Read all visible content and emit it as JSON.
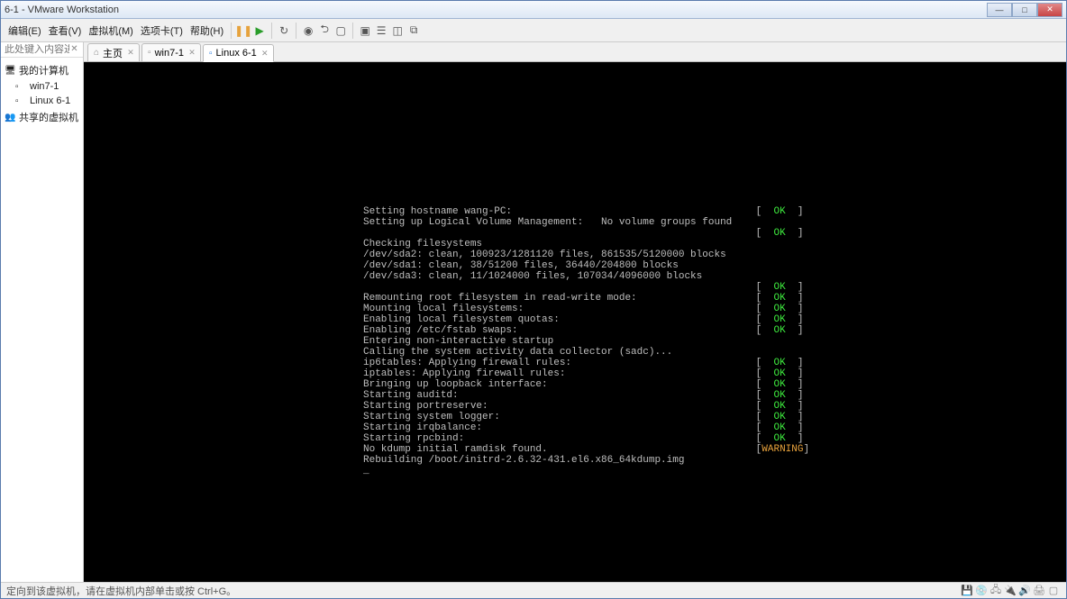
{
  "title": " 6-1 - VMware Workstation",
  "menu": {
    "edit": "编辑(E)",
    "view": "查看(V)",
    "vm": "虚拟机(M)",
    "tabs": "选项卡(T)",
    "help": "帮助(H)"
  },
  "win_controls": {
    "min": "—",
    "max": "□",
    "close": "✕"
  },
  "toolbar_icons": {
    "pause": "❚❚",
    "play": "▶",
    "send": "↻",
    "snapshot": "◉",
    "back": "⮌",
    "screen1": "▢",
    "screen2": "▣",
    "screen3": "☰",
    "screen4": "◫",
    "screen5": "⧉"
  },
  "sidebar": {
    "search_placeholder": "此处键入内容进行…",
    "items": [
      {
        "label": "我的计算机",
        "icon": "🖥"
      },
      {
        "label": "win7-1",
        "icon": "▫",
        "child": true
      },
      {
        "label": "Linux 6-1",
        "icon": "▫",
        "child": true
      },
      {
        "label": "共享的虚拟机",
        "icon": "👥"
      }
    ]
  },
  "tabs": [
    {
      "label": "主页",
      "icon": "⌂",
      "active": false,
      "closable": true
    },
    {
      "label": "win7-1",
      "icon": "▫",
      "active": false,
      "closable": true
    },
    {
      "label": "Linux 6-1",
      "icon": "▫",
      "active": true,
      "closable": true
    }
  ],
  "terminal_lines": [
    {
      "text": "Setting hostname wang-PC:",
      "status": "OK"
    },
    {
      "text": "Setting up Logical Volume Management:   No volume groups found",
      "status": null
    },
    {
      "text": "",
      "status": "OK"
    },
    {
      "text": "Checking filesystems",
      "status": null
    },
    {
      "text": "/dev/sda2: clean, 100923/1281120 files, 861535/5120000 blocks",
      "status": null
    },
    {
      "text": "/dev/sda1: clean, 38/51200 files, 36440/204800 blocks",
      "status": null
    },
    {
      "text": "/dev/sda3: clean, 11/1024000 files, 107034/4096000 blocks",
      "status": null
    },
    {
      "text": "",
      "status": "OK"
    },
    {
      "text": "Remounting root filesystem in read-write mode:",
      "status": "OK"
    },
    {
      "text": "Mounting local filesystems:",
      "status": "OK"
    },
    {
      "text": "Enabling local filesystem quotas:",
      "status": "OK"
    },
    {
      "text": "Enabling /etc/fstab swaps:",
      "status": "OK"
    },
    {
      "text": "Entering non-interactive startup",
      "status": null
    },
    {
      "text": "Calling the system activity data collector (sadc)...",
      "status": null
    },
    {
      "text": "ip6tables: Applying firewall rules:",
      "status": "OK"
    },
    {
      "text": "iptables: Applying firewall rules:",
      "status": "OK"
    },
    {
      "text": "Bringing up loopback interface:",
      "status": "OK"
    },
    {
      "text": "Starting auditd:",
      "status": "OK"
    },
    {
      "text": "Starting portreserve:",
      "status": "OK"
    },
    {
      "text": "Starting system logger:",
      "status": "OK"
    },
    {
      "text": "Starting irqbalance:",
      "status": "OK"
    },
    {
      "text": "Starting rpcbind:",
      "status": "OK"
    },
    {
      "text": "No kdump initial ramdisk found.",
      "status": "WARNING"
    },
    {
      "text": "Rebuilding /boot/initrd-2.6.32-431.el6.x86_64kdump.img",
      "status": null
    }
  ],
  "status_text": "定向到该虚拟机，请在虚拟机内部单击或按 Ctrl+G。"
}
